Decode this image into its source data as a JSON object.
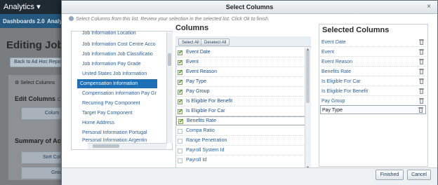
{
  "app": {
    "title": "Analytics",
    "menu_caret": "▾",
    "nav": [
      "Dashboards 2.0",
      "Analy"
    ]
  },
  "background": {
    "page_title": "Editing Job I",
    "back_button": "Back to Ad Hoc Repo",
    "select_columns": "Select Columns",
    "edit_columns": "Edit Columns",
    "edit_columns_suffix": "C",
    "column_button": "Colum",
    "summary": "Summary of Act",
    "sort_button": "Sort Col",
    "group_button": "Grou"
  },
  "dialog": {
    "title": "Select Columns",
    "close": "×",
    "instructions": "Select Columns from this list. Review your selection in the selected list. Click Ok to finish.",
    "tree": [
      {
        "label": "Job Information Location",
        "selected": false
      },
      {
        "label": "Job Information Cost Centre Acco",
        "selected": false
      },
      {
        "label": "Job Information Job Classificatio",
        "selected": false
      },
      {
        "label": "Job Information Pay Grade",
        "selected": false
      },
      {
        "label": "United States Job Information",
        "selected": false
      },
      {
        "label": "Compensation Information",
        "selected": true
      },
      {
        "label": "Compensation Information Pay Gr",
        "selected": false
      },
      {
        "label": "Recurring Pay Component",
        "selected": false
      },
      {
        "label": "Target Pay Component",
        "selected": false
      },
      {
        "label": "Home Address",
        "selected": false
      },
      {
        "label": "Personal Information Portugal",
        "selected": false
      },
      {
        "label": "Personal Information Argentin",
        "selected": false
      }
    ],
    "columns": {
      "header": "Columns",
      "select_all": "Select All",
      "deselect_all": "Deselect All",
      "items": [
        {
          "label": "Event Date",
          "checked": true
        },
        {
          "label": "Event",
          "checked": true
        },
        {
          "label": "Event Reason",
          "checked": true
        },
        {
          "label": "Pay Type",
          "checked": true
        },
        {
          "label": "Pay Group",
          "checked": true
        },
        {
          "label": "Is Eligible For Benefit",
          "checked": true
        },
        {
          "label": "Is Eligible For Car",
          "checked": true
        },
        {
          "label": "Benefits Rate",
          "checked": true
        },
        {
          "label": "Compa Ratio",
          "checked": false
        },
        {
          "label": "Range Penetration",
          "checked": false
        },
        {
          "label": "Payroll System Id",
          "checked": false
        },
        {
          "label": "Payroll Id",
          "checked": false
        }
      ]
    },
    "selected": {
      "header": "Selected Columns",
      "items": [
        "Event Date",
        "Event",
        "Event Reason",
        "Benefits Rate",
        "Is Eligible For Car",
        "Is Eligible For Benefit",
        "Pay Group",
        "Pay Type"
      ]
    },
    "finish": "Finished",
    "cancel": "Cancel"
  }
}
